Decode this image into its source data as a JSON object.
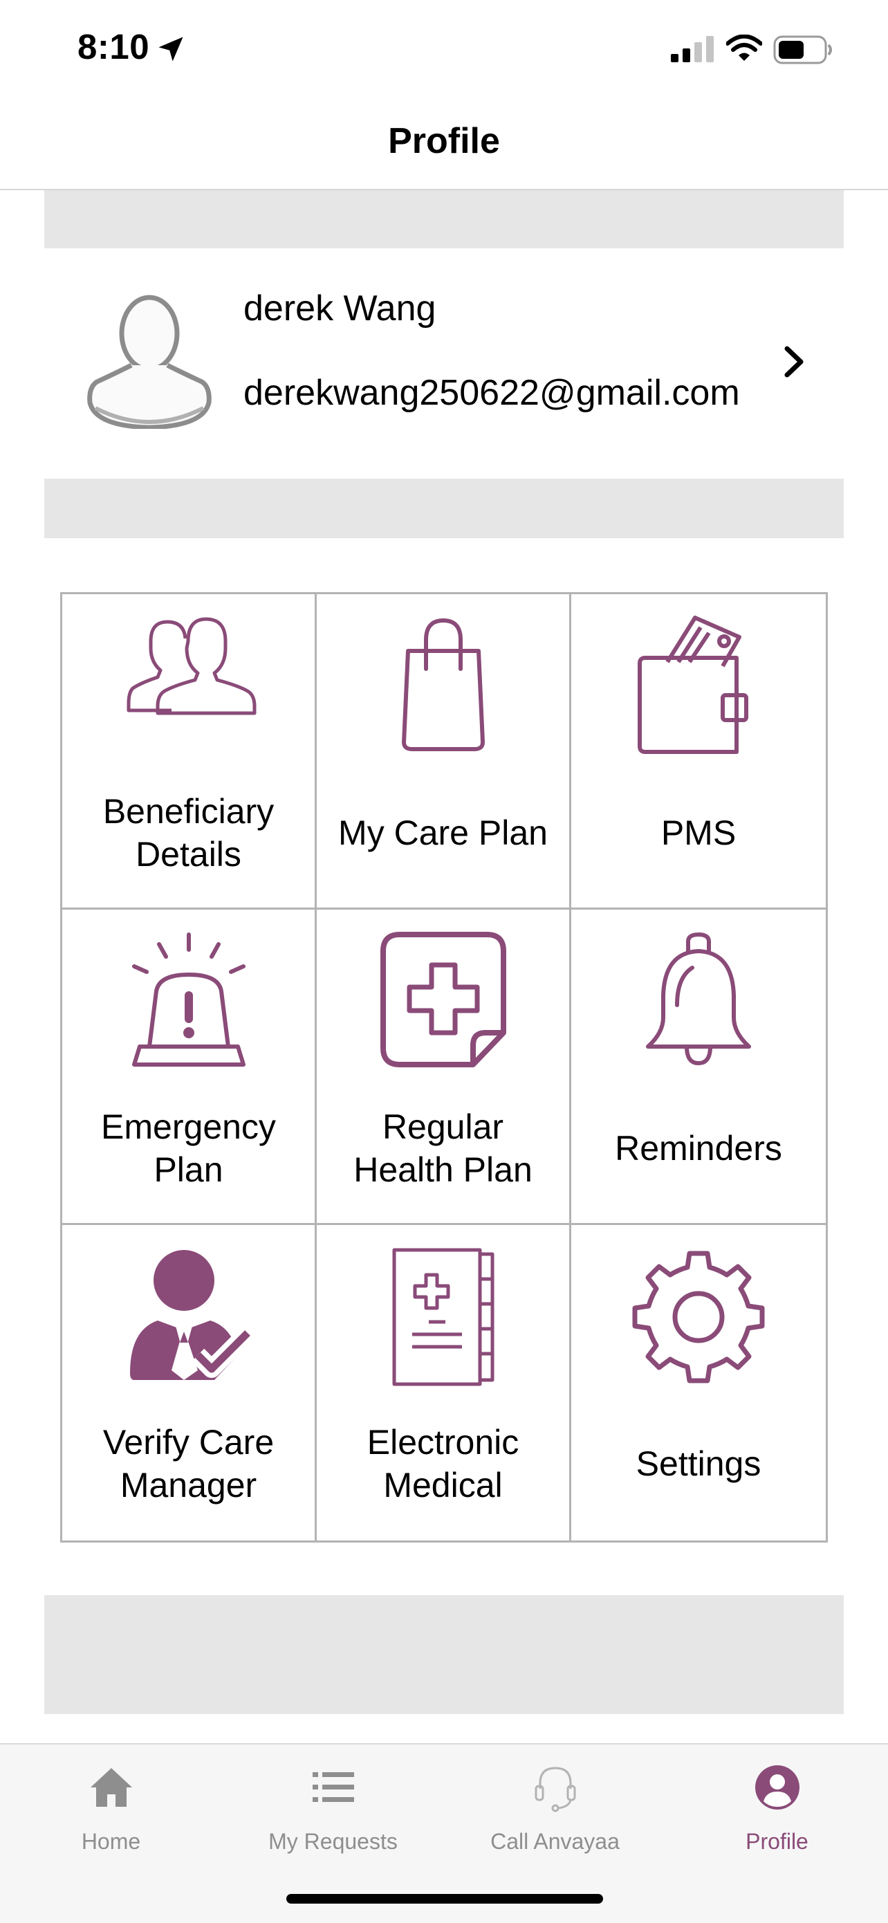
{
  "status_bar": {
    "time": "8:10",
    "icons": [
      "location-arrow-icon",
      "signal-icon",
      "wifi-icon",
      "battery-icon"
    ]
  },
  "header": {
    "title": "Profile"
  },
  "profile": {
    "name": "derek Wang",
    "email": "derekwang250622@gmail.com",
    "avatar_icon": "user-silhouette-icon"
  },
  "grid": {
    "tiles": [
      {
        "label": "Beneficiary Details",
        "icon": "beneficiary-icon"
      },
      {
        "label": "My Care Plan",
        "icon": "shopping-bag-icon"
      },
      {
        "label": "PMS",
        "icon": "wallet-icon"
      },
      {
        "label": "Emergency Plan",
        "icon": "siren-icon"
      },
      {
        "label": "Regular Health Plan",
        "icon": "medical-plus-note-icon"
      },
      {
        "label": "Reminders",
        "icon": "bell-icon"
      },
      {
        "label": "Verify Care Manager",
        "icon": "verified-manager-icon"
      },
      {
        "label": "Electronic Medical",
        "icon": "medical-record-book-icon"
      },
      {
        "label": "Settings",
        "icon": "gear-icon"
      }
    ]
  },
  "tab_bar": {
    "tabs": [
      {
        "label": "Home",
        "icon": "home-icon"
      },
      {
        "label": "My Requests",
        "icon": "list-icon"
      },
      {
        "label": "Call Anvayaa",
        "icon": "headset-icon"
      },
      {
        "label": "Profile",
        "icon": "profile-icon"
      }
    ],
    "active": "Profile"
  },
  "colors": {
    "accent": "#8a4b78",
    "inactive": "#8e8e8e",
    "separator_bar": "#e6e6e6",
    "grid_border": "#b3b3b3"
  }
}
